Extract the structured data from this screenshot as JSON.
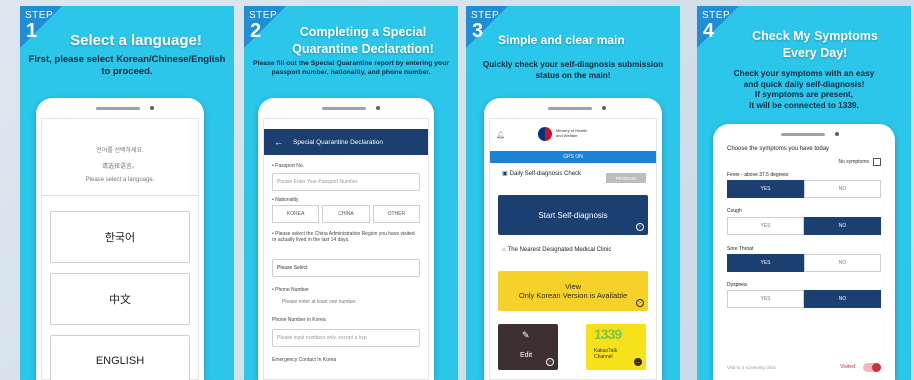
{
  "panels": [
    {
      "step_label": "STEP",
      "step_number": "1",
      "title": "Select a language!",
      "description": "First, please select Korean/Chinese/English to proceed.",
      "screen": {
        "prompt_lines": [
          "언어를 선택하세요.",
          "请选择语言。",
          "Please select a language."
        ],
        "options": [
          "한국어",
          "中文",
          "ENGLISH"
        ]
      }
    },
    {
      "step_label": "STEP",
      "step_number": "2",
      "title_lines": [
        "Completing a Special",
        "Quarantine Declaration!"
      ],
      "description": "Please fill out the Special Quarantine report by entering your passport number, nationality, and phone number.",
      "screen": {
        "header": "Special Quarantine Declaration",
        "passport_label": "• Passport No.",
        "passport_placeholder": "Please Enter Your Passport Number.",
        "nationality_label": "• Nationality",
        "nationality_options": [
          "KOREA",
          "CHINA",
          "OTHER"
        ],
        "region_label": "• Please select the China Administrative Region you have visited or actually lived in the last 14 days.",
        "region_select": "Please Select",
        "phone_label": "• Phone Number",
        "phone_hint": "Please enter at least one number.",
        "korea_phone_label": "Phone Number in Korea",
        "korea_phone_placeholder": "Please input numbers only, except a hyp",
        "emergency_label": "Emergency Contact In Korea"
      }
    },
    {
      "step_label": "STEP",
      "step_number": "3",
      "title": "Simple and clear main",
      "description": "Quickly check your self-diagnosis submission status on the main!",
      "screen": {
        "ministry_name_line1": "Ministry of Health",
        "ministry_name_line2": "and Welfare",
        "gps_status": "GPS ON",
        "daily_check_title": "Daily Self-diagnosis Check",
        "pending_badge": "PENDING",
        "start_button": "Start Self-diagnosis",
        "clinic_title": "The Nearest Designated Medical Clinic",
        "view_button_line1": "View",
        "view_button_line2": "Only Korean Version is Available",
        "edit_button": "Edit",
        "kakao_number": "1339",
        "kakao_line1": "KakaoTalk",
        "kakao_line2": "Channel"
      }
    },
    {
      "step_label": "STEP",
      "step_number": "4",
      "title_lines": [
        "Check My Symptoms",
        "Every Day!"
      ],
      "description_lines": [
        "Check your symptoms with an easy",
        "and quick daily self-diagnosis!",
        "If symptoms are present,",
        "it will be connected to 1339."
      ],
      "screen": {
        "choose_title": "Choose the symptoms you have today",
        "no_symptoms_label": "No symptoms",
        "yes_label": "YES",
        "no_label": "NO",
        "symptoms": [
          {
            "name": "Fever - above 37.5 degrees",
            "selected": "yes"
          },
          {
            "name": "Cough",
            "selected": "no"
          },
          {
            "name": "Sore Throat",
            "selected": "yes"
          },
          {
            "name": "Dyspnea",
            "selected": "no"
          }
        ],
        "visit_label": "Visit to a screening clinic",
        "visited_label": "Visited"
      }
    }
  ]
}
